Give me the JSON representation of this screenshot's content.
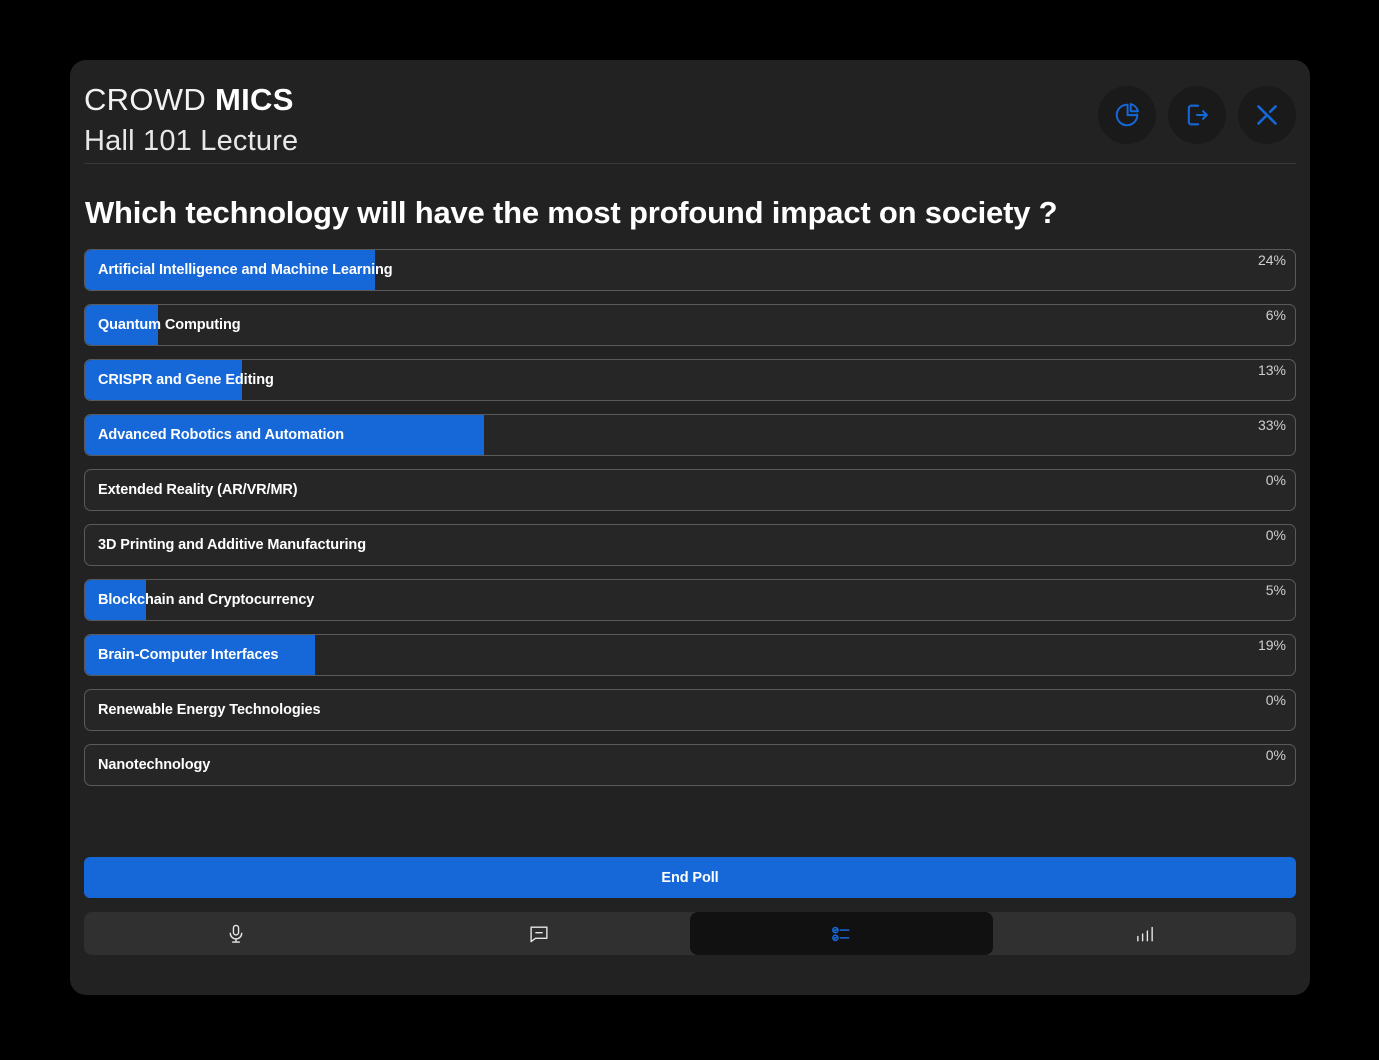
{
  "header": {
    "brand_prefix": "CROWD",
    "brand_bold": "MICS",
    "subtitle": "Hall 101 Lecture",
    "actions": [
      {
        "name": "results-pie-chart-button",
        "icon": "pie-chart-icon"
      },
      {
        "name": "leave-session-button",
        "icon": "logout-icon"
      },
      {
        "name": "close-button",
        "icon": "close-x-icon"
      }
    ]
  },
  "poll": {
    "question": "Which technology will have the most profound impact on society ?",
    "end_poll_label": "End Poll",
    "options": [
      {
        "label": "Artificial Intelligence and Machine Learning",
        "percent": 24,
        "percent_label": "24%"
      },
      {
        "label": "Quantum Computing",
        "percent": 6,
        "percent_label": "6%"
      },
      {
        "label": "CRISPR and Gene Editing",
        "percent": 13,
        "percent_label": "13%"
      },
      {
        "label": "Advanced Robotics and Automation",
        "percent": 33,
        "percent_label": "33%"
      },
      {
        "label": "Extended Reality (AR/VR/MR)",
        "percent": 0,
        "percent_label": "0%"
      },
      {
        "label": "3D Printing and Additive Manufacturing",
        "percent": 0,
        "percent_label": "0%"
      },
      {
        "label": "Blockchain and Cryptocurrency",
        "percent": 5,
        "percent_label": "5%"
      },
      {
        "label": "Brain-Computer Interfaces",
        "percent": 19,
        "percent_label": "19%"
      },
      {
        "label": "Renewable Energy Technologies",
        "percent": 0,
        "percent_label": "0%"
      },
      {
        "label": "Nanotechnology",
        "percent": 0,
        "percent_label": "0%"
      }
    ]
  },
  "bottom_nav": {
    "items": [
      {
        "name": "nav-microphone",
        "icon": "microphone-icon",
        "active": false
      },
      {
        "name": "nav-chat",
        "icon": "chat-bubble-icon",
        "active": false
      },
      {
        "name": "nav-polls",
        "icon": "poll-list-icon",
        "active": true
      },
      {
        "name": "nav-analytics",
        "icon": "bar-chart-icon",
        "active": false
      }
    ]
  },
  "colors": {
    "accent": "#1668d8",
    "panel": "#222222",
    "page_background": "#000000",
    "bar_track": "#262626",
    "bar_border": "#5a5a5a"
  }
}
